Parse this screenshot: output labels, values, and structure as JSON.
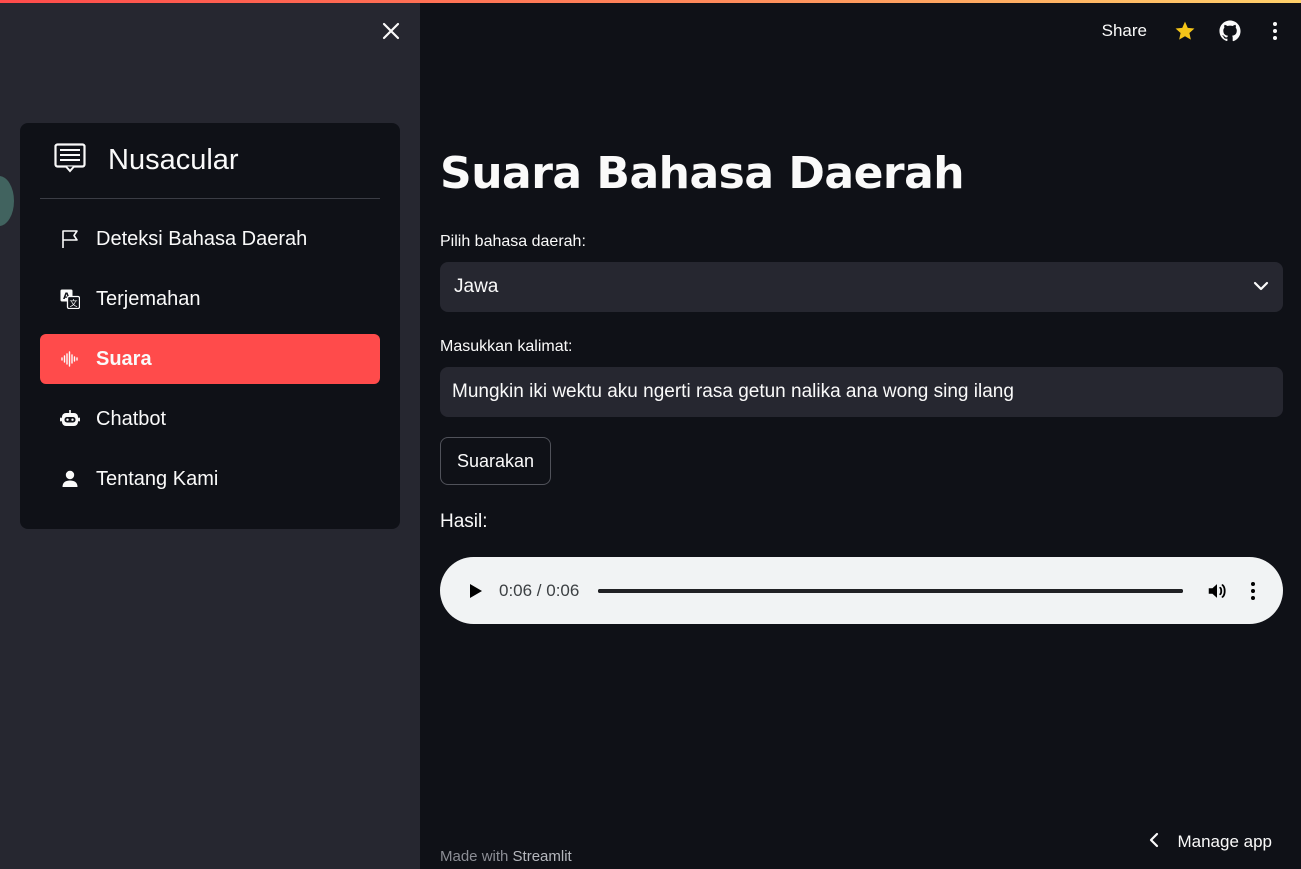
{
  "sidebar": {
    "brand": {
      "title": "Nusacular",
      "icon": "menu-card-icon"
    },
    "items": [
      {
        "label": "Deteksi Bahasa Daerah",
        "icon": "flag-icon",
        "active": false
      },
      {
        "label": "Terjemahan",
        "icon": "translate-icon",
        "active": false
      },
      {
        "label": "Suara",
        "icon": "soundwave-icon",
        "active": true
      },
      {
        "label": "Chatbot",
        "icon": "robot-icon",
        "active": false
      },
      {
        "label": "Tentang Kami",
        "icon": "person-icon",
        "active": false
      }
    ],
    "active_color": "#ff4b4b"
  },
  "header": {
    "share_label": "Share",
    "icons": [
      "star-icon",
      "github-icon",
      "more-vertical-icon"
    ],
    "star_color": "#f5c518"
  },
  "main": {
    "title": "Suara Bahasa Daerah",
    "language_label": "Pilih bahasa daerah:",
    "language_value": "Jawa",
    "sentence_label": "Masukkan kalimat:",
    "sentence_value": "Mungkin iki wektu aku ngerti rasa getun nalika ana wong sing ilang",
    "button_label": "Suarakan",
    "result_label": "Hasil:",
    "audio": {
      "time": "0:06 / 0:06",
      "progress": 1.0
    }
  },
  "footer": {
    "made_with": "Made with ",
    "brand": "Streamlit",
    "manage_label": "Manage app"
  },
  "colors": {
    "background": "#0f1117",
    "sidebar_bg": "#262730",
    "accent": "#ff4b4b"
  }
}
